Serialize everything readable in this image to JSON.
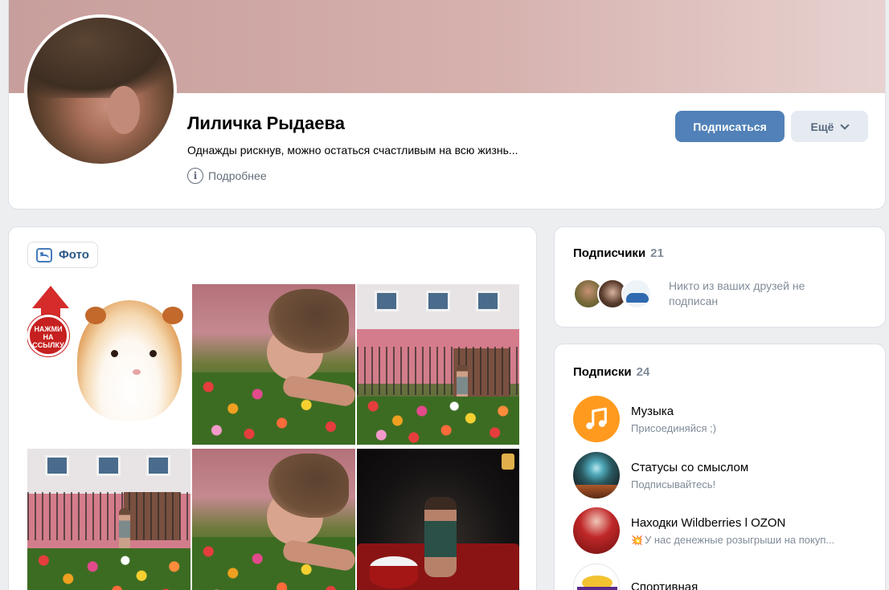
{
  "profile": {
    "name": "Лиличка Рыдаева",
    "status": "Однажды рискнув, можно остаться счастливым на всю жизнь...",
    "more_info_label": "Подробнее",
    "subscribe_label": "Подписаться",
    "more_label": "Ещё"
  },
  "photos": {
    "tab_label": "Фото",
    "badge_text": "НАЖМИ НА ССЫЛКУ"
  },
  "subscribers": {
    "title": "Подписчики",
    "count": "21",
    "note": "Никто из ваших друзей не подписан"
  },
  "following": {
    "title": "Подписки",
    "count": "24",
    "groups": [
      {
        "name": "Музыка",
        "subtitle": "Присоединяйся ;)",
        "icon": "music-note-icon"
      },
      {
        "name": "Статусы со смыслом",
        "subtitle": "Подписывайтесь!"
      },
      {
        "name": "Находки Wildberries l OZON",
        "subtitle": "У нас денежные розыгрыши на покуп...",
        "icon": "sparkle-emoji"
      },
      {
        "name": "Спортивная",
        "subtitle": ""
      }
    ]
  },
  "colors": {
    "accent": "#5181b8",
    "secondary_button": "#e5ebf1",
    "background": "#edeef0",
    "music_orange": "#ff9a1f"
  }
}
